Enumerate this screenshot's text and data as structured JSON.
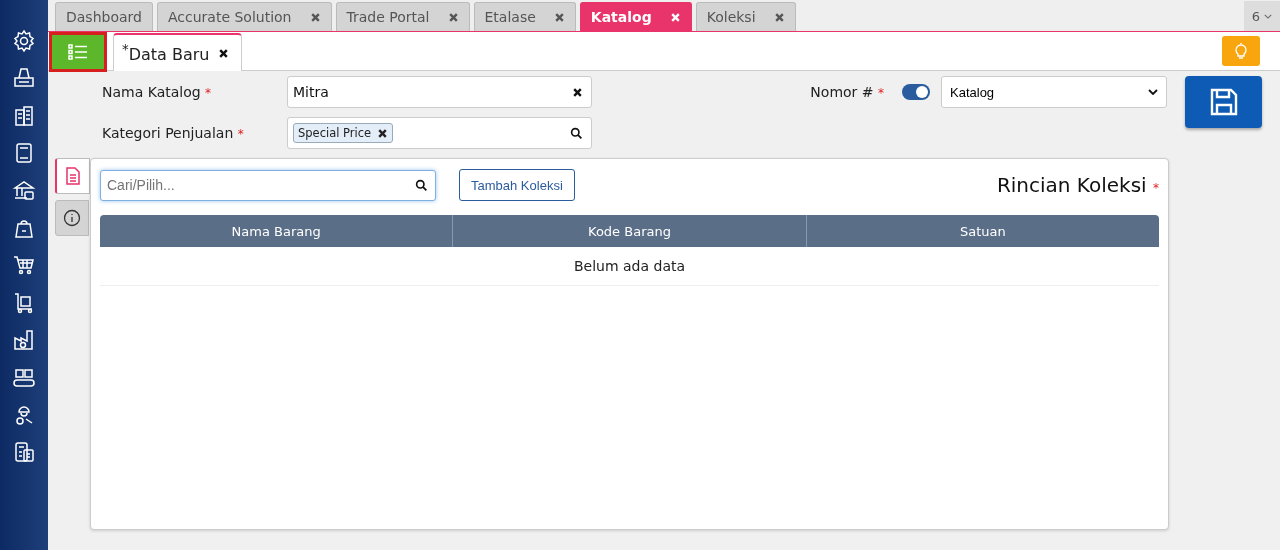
{
  "tabs": [
    {
      "label": "Dashboard",
      "closable": false,
      "selected": false
    },
    {
      "label": "Accurate Solution",
      "closable": true,
      "selected": false
    },
    {
      "label": "Trade Portal",
      "closable": true,
      "selected": false
    },
    {
      "label": "Etalase",
      "closable": true,
      "selected": false
    },
    {
      "label": "Katalog",
      "closable": true,
      "selected": true
    },
    {
      "label": "Koleksi",
      "closable": true,
      "selected": false
    }
  ],
  "tab_overflow": "6",
  "doc_tab": {
    "label": "$^{*}$Data Baru",
    "selected": true
  },
  "form": {
    "nama_katalog": {
      "label": "Nama Katalog",
      "mark": "*",
      "value": "Mitra"
    },
    "kategori_penjualan": {
      "label": "Kategori Penjualan",
      "mark": "*",
      "tags": [
        "Special Price"
      ]
    },
    "nomor": {
      "label": "Nomor #",
      "mark": "*",
      "on": true,
      "value": "Katalog"
    }
  },
  "side_tabs": [
    {
      "kind": "document",
      "selected": true
    },
    {
      "kind": "info",
      "selected": false
    }
  ],
  "panel": {
    "search": {
      "placeholder": "Cari/Pilih..."
    },
    "add_button": "Tambah Koleksi",
    "title": "Rincian Koleksi",
    "title_mark": "*",
    "table": {
      "columns": [
        "Nama Barang",
        "Kode Barang",
        "Satuan"
      ],
      "empty_text": "Belum ada data"
    }
  }
}
